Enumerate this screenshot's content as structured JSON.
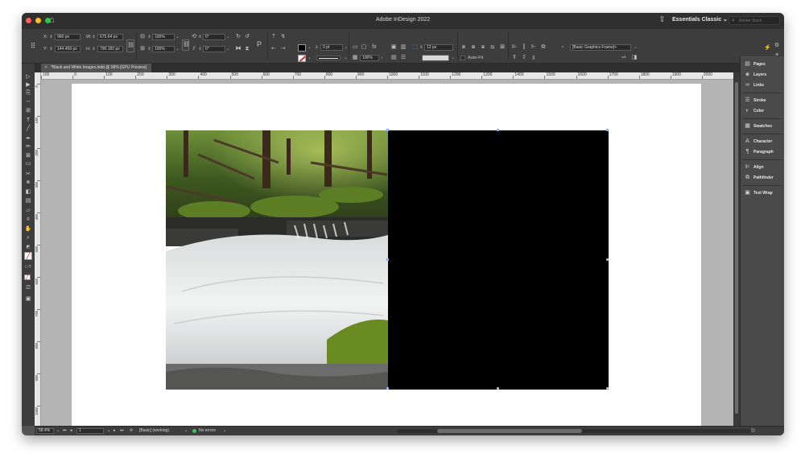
{
  "window": {
    "title": "Adobe InDesign 2022",
    "workspace": "Essentials Classic",
    "search_placeholder": "Adobe Stock",
    "lights": [
      "#ff5f57",
      "#febc2e",
      "#28c840"
    ]
  },
  "control_panel": {
    "x_label": "X:",
    "x_value": "960 px",
    "y_label": "Y:",
    "y_value": "144.459 px",
    "w_label": "W:",
    "w_value": "675.64 px",
    "h_label": "H:",
    "h_value": "790.182 px",
    "scale_x": "100%",
    "scale_y": "100%",
    "rotate": "0°",
    "shear": "0°",
    "stroke_weight": "0 pt",
    "opacity": "100%",
    "frame_size": "12 px",
    "auto_fit_label": "Auto-Fit",
    "object_style": "[Basic Graphics Frame]+"
  },
  "document_tab": {
    "label": "*Black and White Images.indd @ 58% [GPU Preview]"
  },
  "ruler": {
    "h_ticks": [
      "100",
      "0",
      "100",
      "200",
      "300",
      "400",
      "500",
      "600",
      "700",
      "800",
      "900",
      "1000",
      "1100",
      "1200",
      "1300",
      "1400",
      "1500",
      "1600",
      "1700",
      "1800",
      "1900",
      "2000"
    ],
    "v_ticks": [
      "0",
      "100",
      "200",
      "300",
      "400",
      "500",
      "600",
      "700",
      "800",
      "900",
      "1000",
      "1100"
    ]
  },
  "panels": {
    "items": [
      {
        "label": "Pages",
        "icon": "pages-icon",
        "glyph": "▤"
      },
      {
        "label": "Layers",
        "icon": "layers-icon",
        "glyph": "◈"
      },
      {
        "label": "Links",
        "icon": "links-icon",
        "glyph": "∞"
      },
      {
        "label": "Stroke",
        "icon": "stroke-icon",
        "glyph": "☰"
      },
      {
        "label": "Color",
        "icon": "color-icon",
        "glyph": "◐"
      },
      {
        "label": "Swatches",
        "icon": "swatches-icon",
        "glyph": "▦"
      },
      {
        "label": "Character",
        "icon": "character-icon",
        "glyph": "A"
      },
      {
        "label": "Paragraph",
        "icon": "paragraph-icon",
        "glyph": "¶"
      },
      {
        "label": "Align",
        "icon": "align-icon",
        "glyph": "⊫"
      },
      {
        "label": "Pathfinder",
        "icon": "pathfinder-icon",
        "glyph": "⧉"
      },
      {
        "label": "Text Wrap",
        "icon": "text-wrap-icon",
        "glyph": "▣"
      }
    ]
  },
  "status_bar": {
    "zoom": "58.4%",
    "page": "1",
    "preflight_profile": "[Basic] (working)",
    "errors": "No errors"
  },
  "colors": {
    "accent": "#3d7bff",
    "ok": "#3ec25a"
  }
}
